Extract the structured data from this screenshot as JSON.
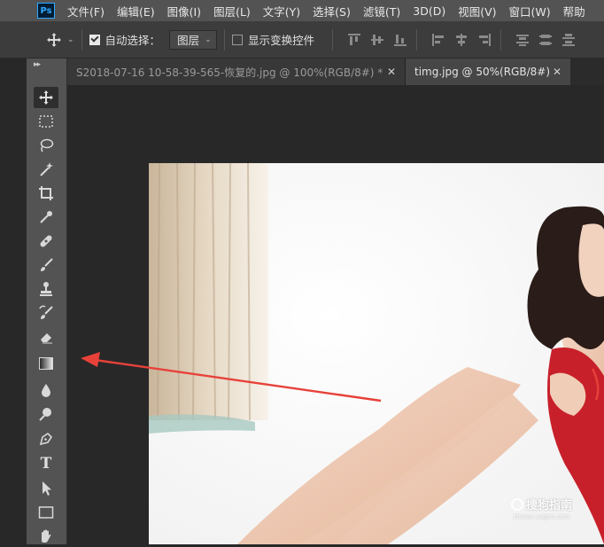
{
  "app": {
    "logo": "Ps"
  },
  "menu": [
    "文件(F)",
    "编辑(E)",
    "图像(I)",
    "图层(L)",
    "文字(Y)",
    "选择(S)",
    "滤镜(T)",
    "3D(D)",
    "视图(V)",
    "窗口(W)",
    "帮助"
  ],
  "options": {
    "auto_select_label": "自动选择：",
    "auto_select_checked": true,
    "auto_select_target": "图层",
    "show_transform_label": "显示变换控件",
    "show_transform_checked": false
  },
  "tabs": [
    {
      "label": "S2018-07-16 10-58-39-565-恢复的.jpg @ 100%(RGB/8#) *",
      "active": false
    },
    {
      "label": "timg.jpg @ 50%(RGB/8#)",
      "active": true
    }
  ],
  "tools": [
    "move-tool-icon",
    "marquee-tool-icon",
    "lasso-tool-icon",
    "magic-wand-tool-icon",
    "crop-tool-icon",
    "eyedropper-tool-icon",
    "healing-brush-tool-icon",
    "brush-tool-icon",
    "clone-stamp-tool-icon",
    "history-brush-tool-icon",
    "eraser-tool-icon",
    "gradient-tool-icon",
    "blur-tool-icon",
    "dodge-tool-icon",
    "pen-tool-icon",
    "type-tool-icon",
    "path-selection-tool-icon",
    "rectangle-tool-icon",
    "hand-tool-icon"
  ],
  "tool_type_glyph": "T",
  "watermark": {
    "main": "搜狗指南",
    "sub": "zhinan.sogou.com"
  },
  "colors": {
    "arrow": "#e8413a",
    "photo_dress": "#c8202a",
    "accent": "#31a8ff"
  }
}
